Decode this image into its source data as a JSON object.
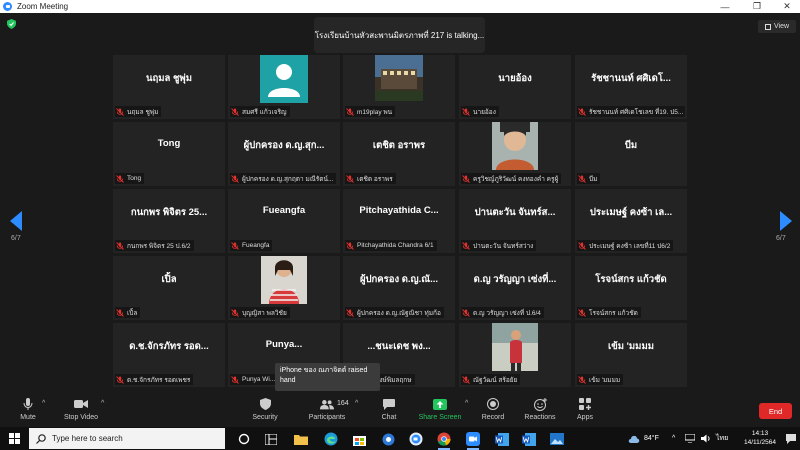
{
  "window": {
    "title": "Zoom Meeting",
    "minimize": "—",
    "maximize": "❐",
    "close": "✕"
  },
  "meeting": {
    "talking_banner": "โรงเรียนบ้านหัวสะพานมิตรภาพที่ 217 is talking...",
    "view_label": "View",
    "page_left": "6/7",
    "page_right": "6/7"
  },
  "tiles": [
    {
      "name": "นฤมล ชูพุ่ม",
      "label": "นฤมล ชูพุ่ม",
      "kind": "name"
    },
    {
      "name": "",
      "label": "สมศรี แก้วเจริญ",
      "kind": "avatar"
    },
    {
      "name": "",
      "label": "m19play พน",
      "kind": "photo-building"
    },
    {
      "name": "นายอ้อง",
      "label": "นายอ้อง",
      "kind": "name"
    },
    {
      "name": "รัชชานนท์ ศศิเดโ...",
      "label": "รัชชานนท์ ศศิเดโชเลข ที่19. ป5...",
      "kind": "name"
    },
    {
      "name": "Tong",
      "label": "Tong",
      "kind": "name"
    },
    {
      "name": "ผู้ปกครอง ด.ญ.สุก...",
      "label": "ผู้ปกครอง ด.ญ.สุกฤตา มณีรัตน์...",
      "kind": "name"
    },
    {
      "name": "เตชิต อราพร",
      "label": "เตชิต อราพร",
      "kind": "name"
    },
    {
      "name": "",
      "label": "ครูวิชญ์ภูริวัฒน์ คงทองคำ ครูผู้",
      "kind": "photo-face"
    },
    {
      "name": "บีม",
      "label": "บีม",
      "kind": "name"
    },
    {
      "name": "กนกพร พิจิตร 25...",
      "label": "กนกพร พิจิตร 25 ป.6/2",
      "kind": "name"
    },
    {
      "name": "Fueangfa",
      "label": "Fueangfa",
      "kind": "name"
    },
    {
      "name": "Pitchayathida  C...",
      "label": "Pitchayathida  Chandra  6/1",
      "kind": "name"
    },
    {
      "name": "ปานตะวัน จันทร์ส...",
      "label": "ปานตะวัน จันทร์สว่าง",
      "kind": "name"
    },
    {
      "name": "ประเมษฐ์ คงซ้า เล...",
      "label": "ประเมษฐ์ คงซ้า เลขที่11 ป6/2",
      "kind": "name"
    },
    {
      "name": "เปิ้ล",
      "label": "เปิ้ล",
      "kind": "name"
    },
    {
      "name": "",
      "label": "บุญญิสา พลวิชัย",
      "kind": "photo-girl"
    },
    {
      "name": "ผู้ปกครอง ด.ญ.ณั...",
      "label": "ผู้ปกครอง ด.ญ.ณัฐณิชา ทุ่มก้อ",
      "kind": "name"
    },
    {
      "name": "ด.ญ วรัญญา เซ่งที่...",
      "label": "ด.ญ วรัญญา เซ่งที่ ป.6/4",
      "kind": "name"
    },
    {
      "name": "โรจน์สกร แก้วชัด",
      "label": "โรจน์สกร แก้วชัด",
      "kind": "name"
    },
    {
      "name": "ด.ช.จักรภัทร รอด...",
      "label": "ด.ช.จักรภัทร รอดเพชร",
      "kind": "name"
    },
    {
      "name": "Punya...",
      "label": "Punya Wi...",
      "kind": "name"
    },
    {
      "name": "...ชนะเดช  พง...",
      "label": "...เดช  พงษ์พิมลฤกษ",
      "kind": "name"
    },
    {
      "name": "",
      "label": "ณัฐวัฒน์ สร้อยัย",
      "kind": "photo-child"
    },
    {
      "name": "เข้ม 'มมมม",
      "label": "เข้ม 'มมมม",
      "kind": "name"
    }
  ],
  "toast": {
    "text": "iPhone ของ ณภาจิตต์ raised hand"
  },
  "controls": {
    "mute": "Mute",
    "stop_video": "Stop Video",
    "security": "Security",
    "participants": "Participants",
    "participant_count": "164",
    "chat": "Chat",
    "share_screen": "Share Screen",
    "record": "Record",
    "reactions": "Reactions",
    "apps": "Apps",
    "end": "End"
  },
  "taskbar": {
    "search_placeholder": "Type here to search",
    "weather": "84°F",
    "language": "ไทย",
    "time": "14:13",
    "date": "14/11/2564"
  },
  "colors": {
    "accent_blue": "#2d8cff",
    "share_green": "#23c55e",
    "end_red": "#e02828",
    "muted_red": "#e0322e"
  }
}
